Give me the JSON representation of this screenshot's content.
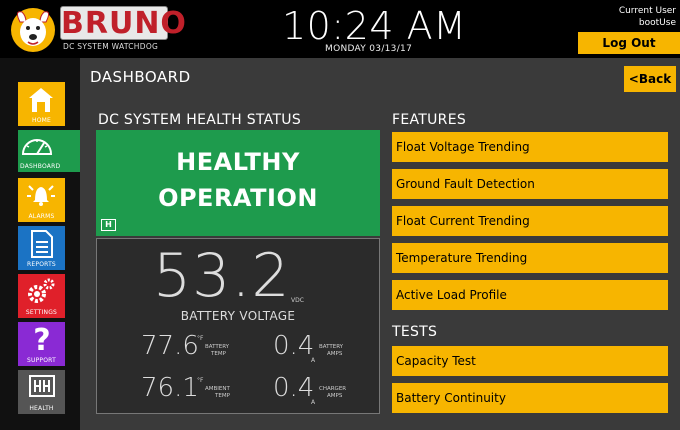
{
  "header": {
    "brand": "BRUNO",
    "brand_sub": "DC SYSTEM WATCHDOG",
    "time": "10:24 AM",
    "date": "MONDAY 03/13/17",
    "user_label": "Current User",
    "user_name": "bootUse",
    "logout_label": "Log Out"
  },
  "sidebar": {
    "items": [
      {
        "label": "HOME",
        "icon": "home-icon"
      },
      {
        "label": "DASHBOARD",
        "icon": "gauge-icon"
      },
      {
        "label": "ALARMS",
        "icon": "bell-icon"
      },
      {
        "label": "REPORTS",
        "icon": "document-icon"
      },
      {
        "label": "SETTINGS",
        "icon": "gear-icon"
      },
      {
        "label": "SUPPORT",
        "icon": "question-icon"
      },
      {
        "label": "HEALTH",
        "icon": "health-logo-icon"
      }
    ]
  },
  "main": {
    "title": "DASHBOARD",
    "back_label": "<Back",
    "health": {
      "section_title": "DC SYSTEM HEALTH STATUS",
      "line1": "HEALTHY",
      "line2": "OPERATION"
    },
    "readings": {
      "battery_voltage": "53.2",
      "battery_voltage_unit": "VDC",
      "battery_voltage_label": "BATTERY VOLTAGE",
      "battery_temp": "77.6",
      "battery_temp_unit": "°F",
      "battery_temp_label_1": "BATTERY",
      "battery_temp_label_2": "TEMP",
      "battery_amps": "0.4",
      "battery_amps_unit": "A",
      "battery_amps_label_1": "BATTERY",
      "battery_amps_label_2": "AMPS",
      "ambient_temp": "76.1",
      "ambient_temp_unit": "°F",
      "ambient_temp_label_1": "AMBIENT",
      "ambient_temp_label_2": "TEMP",
      "charger_amps": "0.4",
      "charger_amps_unit": "A",
      "charger_amps_label_1": "CHARGER",
      "charger_amps_label_2": "AMPS"
    },
    "features": {
      "title": "FEATURES",
      "items": [
        "Float Voltage Trending",
        "Ground Fault Detection",
        "Float Current Trending",
        "Temperature Trending",
        "Active Load Profile"
      ]
    },
    "tests": {
      "title": "TESTS",
      "items": [
        "Capacity Test",
        "Battery Continuity"
      ]
    }
  },
  "colors": {
    "accent_yellow": "#f7b500",
    "healthy_green": "#1e9b4d",
    "reports_blue": "#1b73c4",
    "settings_red": "#e0202a",
    "support_purple": "#8a2ad4"
  }
}
